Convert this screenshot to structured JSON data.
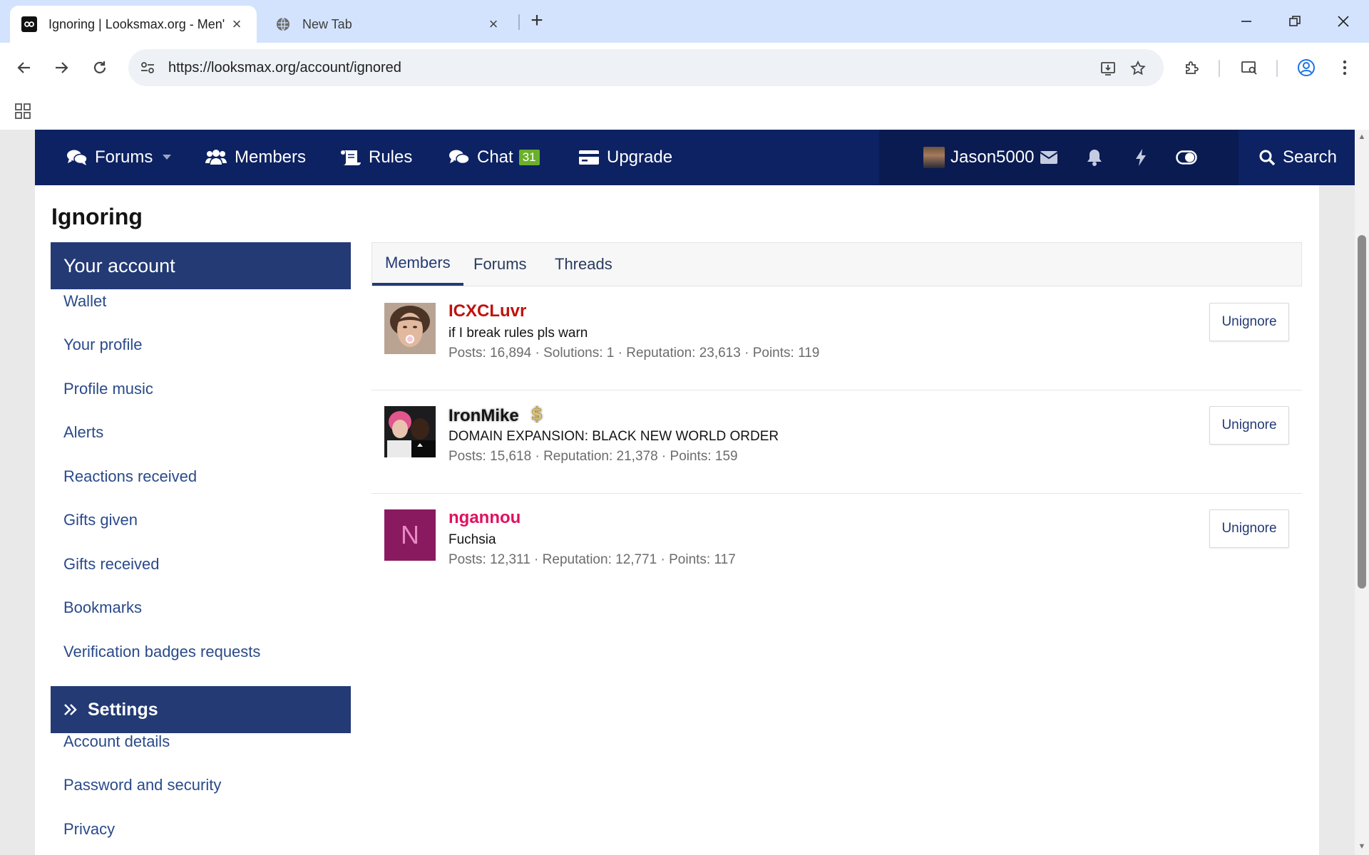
{
  "browser": {
    "tabs": [
      {
        "title": "Ignoring | Looksmax.org - Men'",
        "active": true
      },
      {
        "title": "New Tab",
        "active": false
      }
    ],
    "url": "https://looksmax.org/account/ignored"
  },
  "site_nav": {
    "items": [
      {
        "label": "Forums",
        "icon": "comments-icon"
      },
      {
        "label": "Members",
        "icon": "users-icon"
      },
      {
        "label": "Rules",
        "icon": "scroll-icon"
      },
      {
        "label": "Chat",
        "icon": "chat-icon",
        "badge": "31"
      },
      {
        "label": "Upgrade",
        "icon": "credit-card-icon"
      }
    ],
    "username": "Jason5000",
    "search_label": "Search",
    "colors": {
      "nav_bg": "#0d2262",
      "accent": "#233a75",
      "badge": "#6ab02b"
    }
  },
  "page": {
    "title": "Ignoring",
    "sidebar": {
      "account_header": "Your account",
      "account_links": [
        "Wallet",
        "Your profile",
        "Profile music",
        "Alerts",
        "Reactions received",
        "Gifts given",
        "Gifts received",
        "Bookmarks",
        "Verification badges requests"
      ],
      "settings_header": "Settings",
      "settings_links": [
        "Account details",
        "Password and security",
        "Privacy"
      ]
    },
    "tabs": [
      "Members",
      "Forums",
      "Threads"
    ],
    "active_tab": "Members",
    "members": [
      {
        "name": "ICXCLuvr",
        "name_color": "#c0120d",
        "title": "if I break rules pls warn",
        "stats": "Posts: 16,894 · Solutions: 1 · Reputation: 23,613 · Points: 119",
        "button": "Unignore"
      },
      {
        "name": "IronMike",
        "name_color": "#141414",
        "badge_icon": "dollar-icon",
        "title": "DOMAIN EXPANSION: BLACK NEW WORLD ORDER",
        "stats": "Posts: 15,618 · Reputation: 21,378 · Points: 159",
        "button": "Unignore"
      },
      {
        "name": "ngannou",
        "name_color": "#e0115f",
        "initial": "N",
        "avatar_color": "#8a1a60",
        "title": "Fuchsia",
        "stats": "Posts: 12,311 · Reputation: 12,771 · Points: 117",
        "button": "Unignore"
      }
    ]
  }
}
